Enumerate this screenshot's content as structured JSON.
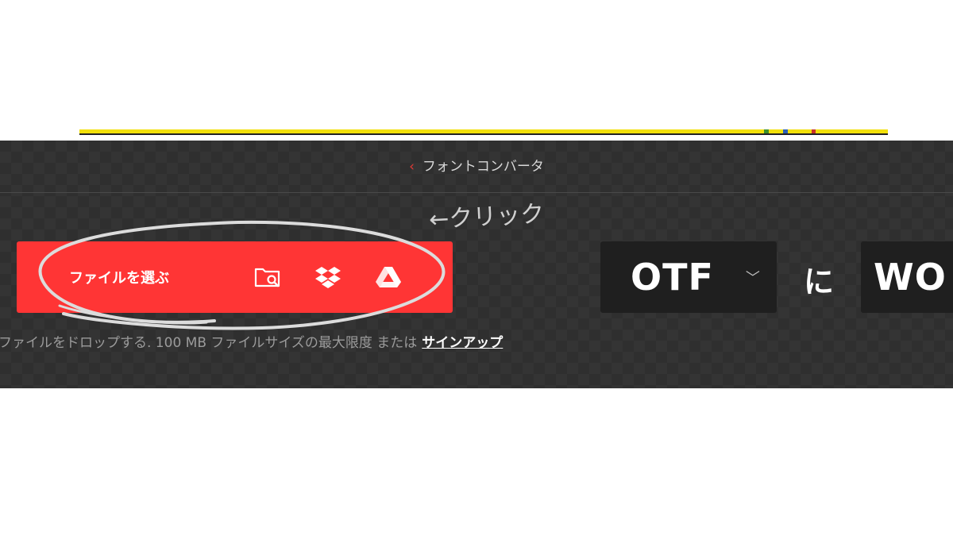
{
  "page": {
    "breadcrumb": "フォントコンバータ",
    "choose_file_label": "ファイルを選ぶ",
    "source_icons": [
      "folder-search-icon",
      "dropbox-icon",
      "google-drive-icon"
    ],
    "drop_hint": "ファイルをドロップする. 100 MB ファイルサイズの最大限度 または",
    "signup_link": "サインアップ",
    "format_from": "OTF",
    "connector": "に",
    "format_to": "WO",
    "annotation": "←クリック"
  },
  "colors": {
    "accent_red": "#ff3535",
    "panel_bg": "#2f2f2f",
    "format_box_bg": "#1f1f1f"
  }
}
